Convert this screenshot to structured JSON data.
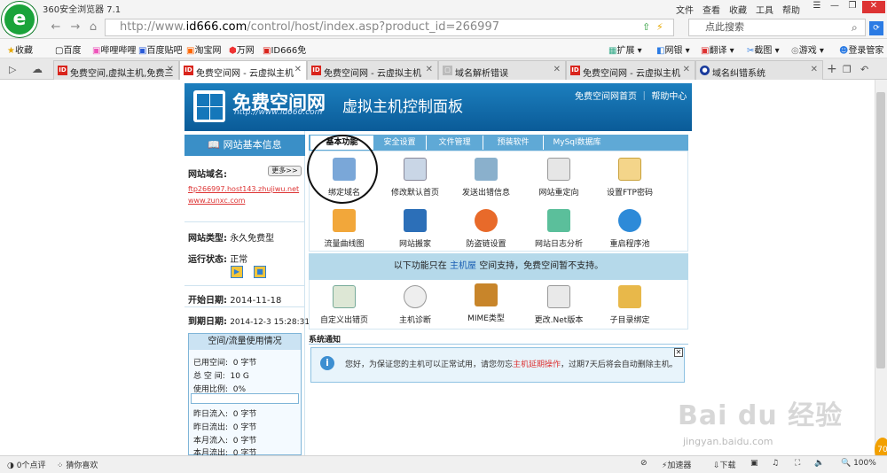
{
  "browser": {
    "name": "360安全浏览器 7.1",
    "menu": [
      "文件",
      "查看",
      "收藏",
      "工具",
      "帮助"
    ],
    "url_prefix": "http://www.",
    "url_domain": "id666.com",
    "url_path": "/control/host/index.asp?product_id=266997",
    "search_placeholder": "点此搜索"
  },
  "bookmarks": [
    "收藏",
    "百度",
    "哔哩哔哩",
    "百度贴吧",
    "淘宝网",
    "万网",
    "ID666免",
    "扩展",
    "网银",
    "翻译",
    "截图",
    "游戏",
    "登录管家"
  ],
  "tabs": [
    {
      "label": "免费空间,虚拟主机,免费三"
    },
    {
      "label": "免费空间网 - 云虚拟主机"
    },
    {
      "label": "免费空间网 - 云虚拟主机"
    },
    {
      "label": "域名解析错误"
    },
    {
      "label": "免费空间网 - 云虚拟主机"
    },
    {
      "label": "域名纠错系统"
    }
  ],
  "banner": {
    "title": "免费空间网",
    "url": "http://www.id666.com",
    "subtitle": "虚拟主机控制面板",
    "links": "免费空间网首页 ｜ 帮助中心"
  },
  "sidebar": {
    "heading": "网站基本信息",
    "domain_label": "网站域名:",
    "more": "更多>>",
    "domain1": "ftp266997.host143.zhujiwu.net",
    "domain2": "www.zunxc.com",
    "type_label": "网站类型:",
    "type_value": "永久免费型",
    "status_label": "运行状态:",
    "status_value": "正常",
    "start_label": "开始日期:",
    "start_value": "2014-11-18",
    "end_label": "到期日期:",
    "end_value": "2014-12-3 15:28:31"
  },
  "usage": {
    "heading": "空间/流量使用情况",
    "used_label": "已用空间:",
    "used_value": "0 字节",
    "total_label": "总  空  间:",
    "total_value": "10 G",
    "ratio_label": "使用比例:",
    "ratio_value": "0%",
    "in_y_label": "昨日流入:",
    "in_y_value": "0 字节",
    "out_y_label": "昨日流出:",
    "out_y_value": "0 字节",
    "in_m_label": "本月流入:",
    "in_m_value": "0 字节",
    "out_m_label": "本月流出:",
    "out_m_value": "0 字节"
  },
  "main_tabs": [
    "基本功能",
    "安全设置",
    "文件管理",
    "预装软件",
    "MySql数据库"
  ],
  "features_row1": [
    "绑定域名",
    "修改默认首页",
    "发送出错信息",
    "网站重定向",
    "设置FTP密码"
  ],
  "features_row2": [
    "流量曲线图",
    "网站搬家",
    "防盗链设置",
    "网站日志分析",
    "重启程序池"
  ],
  "note": {
    "pre": "以下功能只在",
    "link": "主机屋",
    "post": "空间支持，免费空间暂不支持。"
  },
  "features_row3": [
    "自定义出错页",
    "主机诊断",
    "MIME类型",
    "更改.Net版本",
    "子目录绑定"
  ],
  "system": {
    "heading": "系统通知",
    "pre": "您好，为保证您的主机可以正常试用，请您勿忘",
    "red": "主机延期操作",
    "post": "，过期7天后将会自动删除主机。"
  },
  "statusbar": {
    "left1": "0个点评",
    "left2": "猜你喜欢",
    "right1": "加速器",
    "right2": "下载",
    "zoom": "100%"
  },
  "watermark": {
    "text": "Bai du 经验",
    "sub": "jingyan.baidu.com"
  },
  "badge": "70"
}
